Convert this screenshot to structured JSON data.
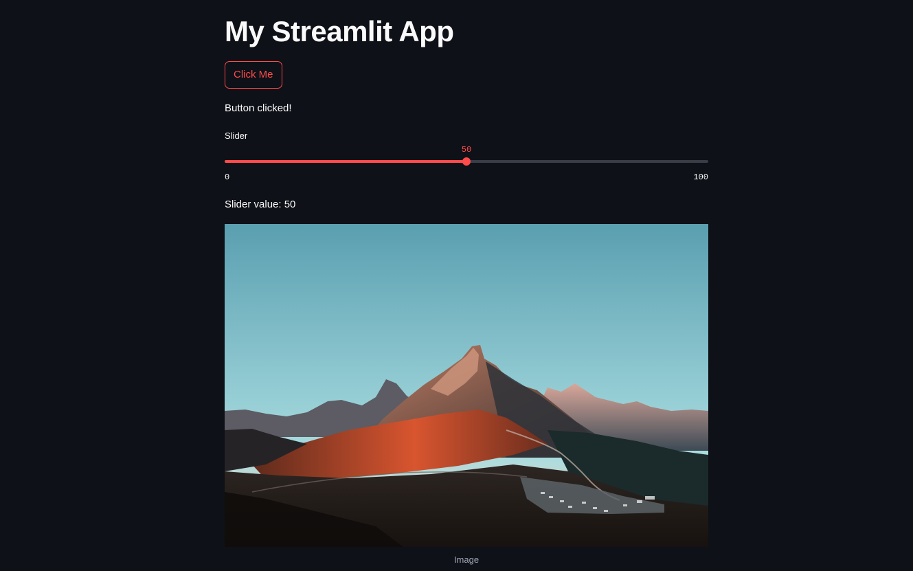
{
  "app": {
    "title": "My Streamlit App"
  },
  "button": {
    "label": "Click Me"
  },
  "status": {
    "message": "Button clicked!"
  },
  "slider": {
    "label": "Slider",
    "value": 50,
    "min": 0,
    "max": 100,
    "value_text": "50",
    "min_text": "0",
    "max_text": "100",
    "fill_fraction": 0.5
  },
  "slider_output": {
    "text": "Slider value: 50"
  },
  "image": {
    "caption": "Image"
  },
  "colors": {
    "background": "#0e1117",
    "accent": "#ff4b4b",
    "text": "#fafafa",
    "caption": "#a3a8b8",
    "track": "#3a3d45"
  }
}
